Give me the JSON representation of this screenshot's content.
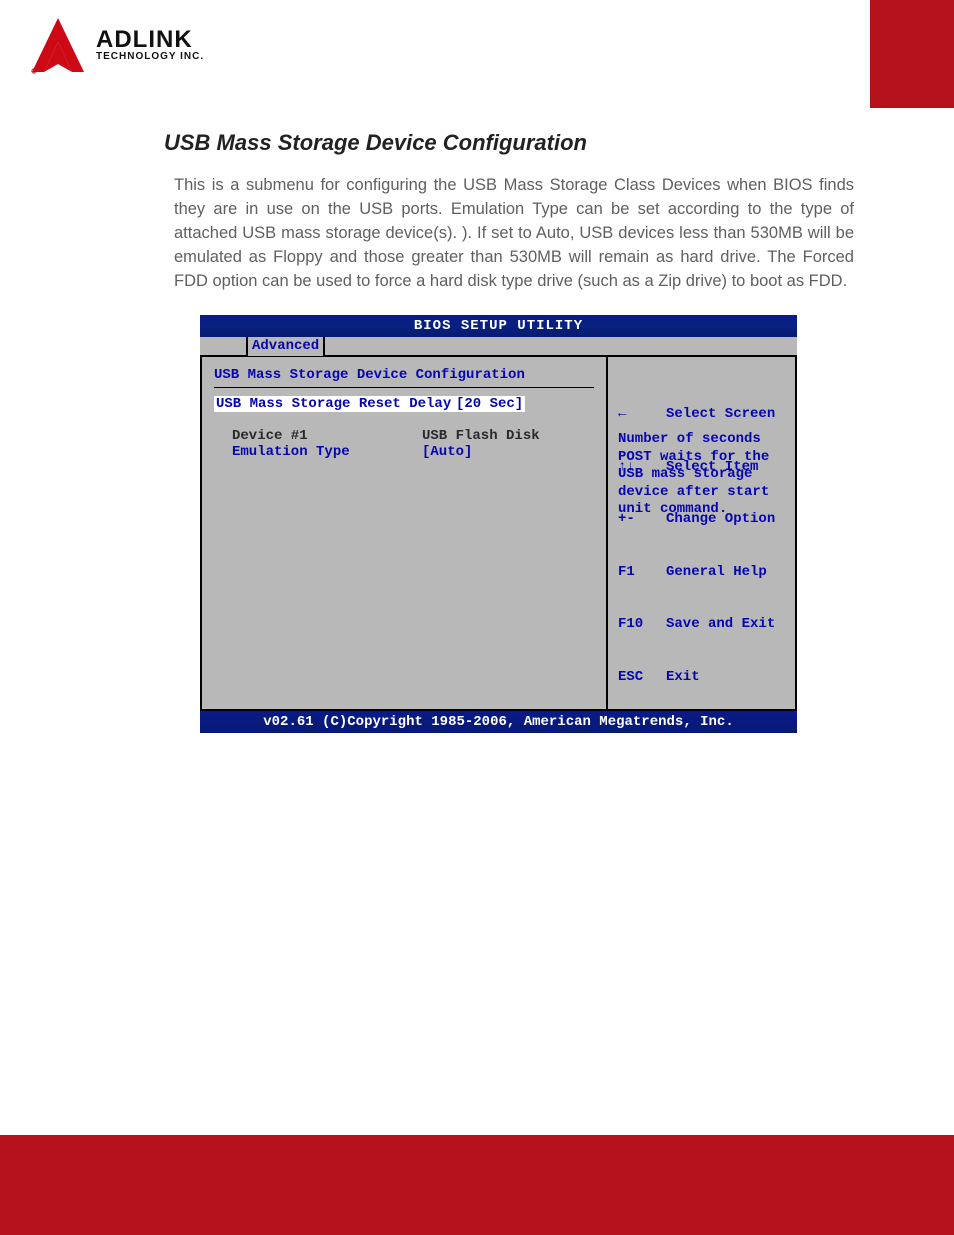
{
  "logo": {
    "brand": "ADLINK",
    "sub": "TECHNOLOGY INC."
  },
  "section": {
    "title": "USB Mass Storage Device Configuration",
    "body": "This is a submenu for configuring the USB Mass Storage Class Devices when BIOS finds they are in use on the USB ports. Emulation Type can be set according to the type of attached USB mass storage device(s). ). If set to Auto, USB devices less than 530MB will be emulated as Floppy and those greater than 530MB will remain as hard drive. The Forced FDD option can be used to force a hard disk type drive (such as a Zip drive) to boot as FDD."
  },
  "bios": {
    "title": "BIOS SETUP UTILITY",
    "tab": "Advanced",
    "menu_title": "USB Mass Storage Device Configuration",
    "rows": {
      "reset_delay_label": "USB Mass Storage Reset Delay",
      "reset_delay_value": "[20 Sec]",
      "device_label": "Device #1",
      "device_value": "USB Flash Disk",
      "emu_label": "Emulation Type",
      "emu_value": "[Auto]"
    },
    "help_text": "Number of seconds\nPOST waits for the\nUSB mass storage\ndevice after start\nunit command.",
    "keys": [
      {
        "k": "←",
        "d": "Select Screen"
      },
      {
        "k": "↑↓",
        "d": "Select Item"
      },
      {
        "k": "+-",
        "d": "Change Option"
      },
      {
        "k": "F1",
        "d": "General Help"
      },
      {
        "k": "F10",
        "d": "Save and Exit"
      },
      {
        "k": "ESC",
        "d": "Exit"
      }
    ],
    "footer": "v02.61 (C)Copyright 1985-2006, American Megatrends, Inc."
  }
}
